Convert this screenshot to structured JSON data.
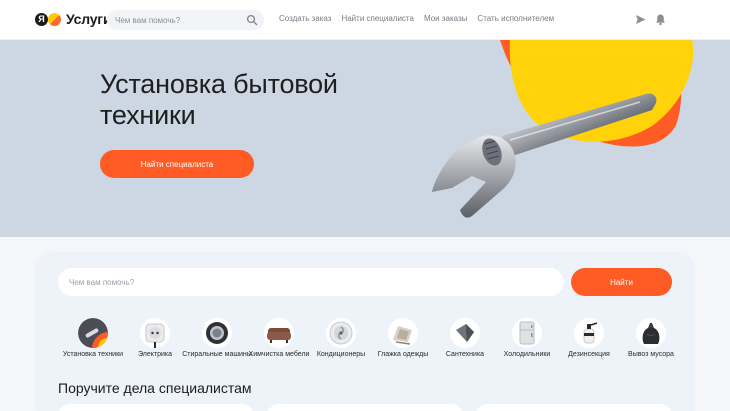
{
  "header": {
    "logo_text": "Услуги",
    "logo_mark": "Я",
    "search_placeholder": "Чем вам помочь?",
    "nav": [
      {
        "label": "Создать заказ"
      },
      {
        "label": "Найти специалиста"
      },
      {
        "label": "Мои заказы"
      },
      {
        "label": "Стать исполнителем"
      }
    ],
    "icons": [
      "send-icon",
      "bell-icon"
    ]
  },
  "hero": {
    "title": "Установка бытовой техники",
    "button_label": "Найти специалиста",
    "illustration": "wrench-icon"
  },
  "main": {
    "search_placeholder": "Чем вам помочь?",
    "find_label": "Найти",
    "categories": [
      {
        "label": "Установка техники"
      },
      {
        "label": "Электрика"
      },
      {
        "label": "Стиральные машины"
      },
      {
        "label": "Химчистка мебели"
      },
      {
        "label": "Кондиционеры"
      },
      {
        "label": "Глажка одежды"
      },
      {
        "label": "Сантехника"
      },
      {
        "label": "Холодильники"
      },
      {
        "label": "Дезинсекция"
      },
      {
        "label": "Вывоз мусора"
      }
    ],
    "section_title": "Поручите дела специалистам"
  },
  "colors": {
    "accent": "#ff5b25",
    "hero_bg": "#cdd7e3",
    "card_bg": "#eef3fa",
    "yellow": "#ffcc00"
  }
}
